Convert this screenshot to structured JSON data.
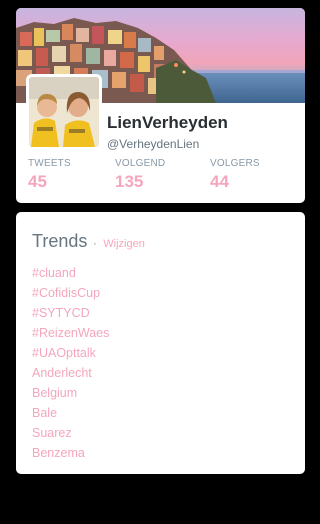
{
  "profile": {
    "name": "LienVerheyden",
    "handle": "@VerheydenLien",
    "stats": [
      {
        "label": "TWEETS",
        "value": "45"
      },
      {
        "label": "VOLGEND",
        "value": "135"
      },
      {
        "label": "VOLGERS",
        "value": "44"
      }
    ]
  },
  "trends": {
    "title": "Trends",
    "separator": "·",
    "change_label": "Wijzigen",
    "items": [
      "#cluand",
      "#CofidisCup",
      "#SYTYCD",
      "#ReizenWaes",
      "#UAOpttalk",
      "Anderlecht",
      "Belgium",
      "Bale",
      "Suarez",
      "Benzema"
    ]
  },
  "colors": {
    "accent": "#f5a6bc",
    "background": "#000000",
    "card": "#ffffff",
    "muted": "#8899a6"
  }
}
